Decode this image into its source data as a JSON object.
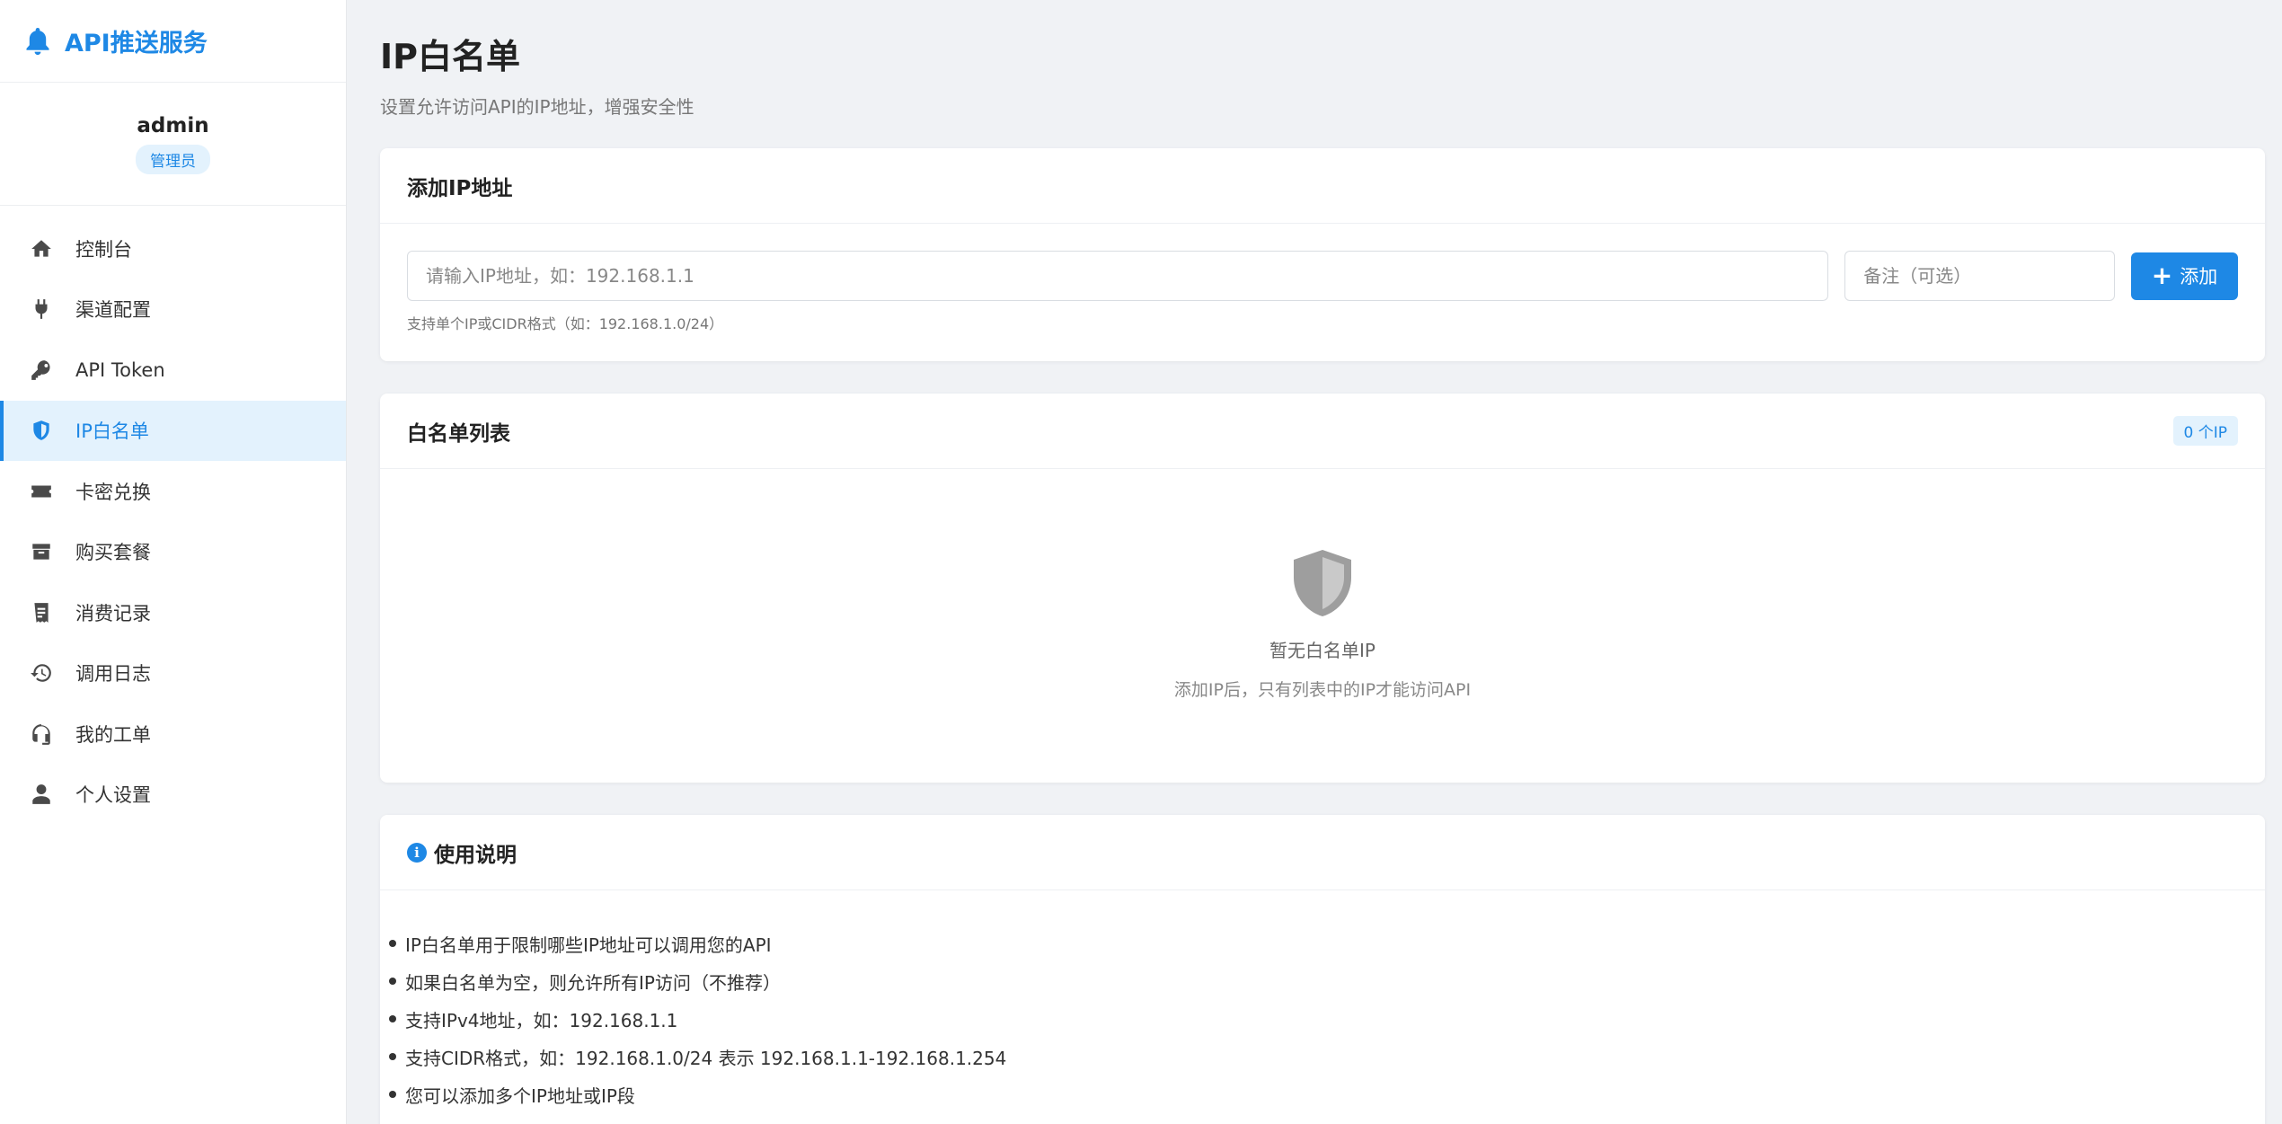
{
  "brand": {
    "title": "API推送服务",
    "icon": "bell-icon",
    "color": "#1e88e5"
  },
  "user": {
    "name": "admin",
    "role": "管理员"
  },
  "nav": [
    {
      "label": "控制台",
      "icon": "home-icon"
    },
    {
      "label": "渠道配置",
      "icon": "plug-icon"
    },
    {
      "label": "API Token",
      "icon": "key-icon"
    },
    {
      "label": "IP白名单",
      "icon": "shield-icon",
      "active": true
    },
    {
      "label": "卡密兑换",
      "icon": "ticket-icon"
    },
    {
      "label": "购买套餐",
      "icon": "box-icon"
    },
    {
      "label": "消费记录",
      "icon": "receipt-icon"
    },
    {
      "label": "调用日志",
      "icon": "history-icon"
    },
    {
      "label": "我的工单",
      "icon": "headset-icon"
    },
    {
      "label": "个人设置",
      "icon": "user-icon"
    }
  ],
  "page": {
    "title": "IP白名单",
    "subtitle": "设置允许访问API的IP地址，增强安全性"
  },
  "add_card": {
    "title": "添加IP地址",
    "ip_placeholder": "请输入IP地址，如：192.168.1.1",
    "ip_value": "",
    "note_placeholder": "备注（可选）",
    "note_value": "",
    "button_label": "添加",
    "hint": "支持单个IP或CIDR格式（如：192.168.1.0/24）"
  },
  "list_card": {
    "title": "白名单列表",
    "count": "0 个IP",
    "empty_title": "暂无白名单IP",
    "empty_desc": "添加IP后，只有列表中的IP才能访问API"
  },
  "help_card": {
    "title": "使用说明",
    "items": [
      "IP白名单用于限制哪些IP地址可以调用您的API",
      "如果白名单为空，则允许所有IP访问（不推荐）",
      "支持IPv4地址，如：192.168.1.1",
      "支持CIDR格式，如：192.168.1.0/24 表示 192.168.1.1-192.168.1.254",
      "您可以添加多个IP地址或IP段"
    ]
  }
}
